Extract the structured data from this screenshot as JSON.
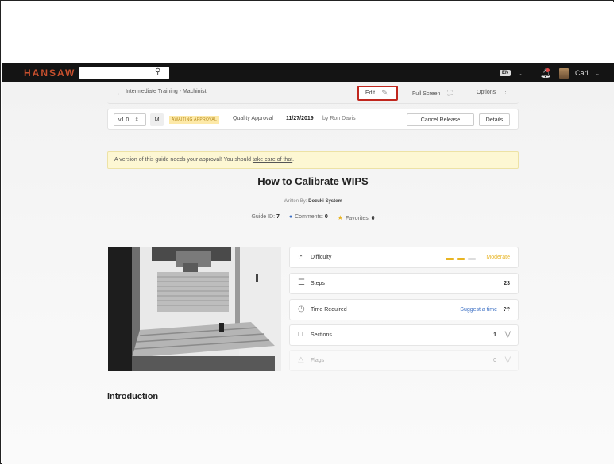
{
  "app": {
    "brand": "HANSAW",
    "search_placeholder": "",
    "lang": "EN",
    "user": "Carl"
  },
  "nav": {
    "breadcrumb": "Intermediate Training - Machinist",
    "edit": "Edit",
    "full_screen": "Full Screen",
    "options": "Options"
  },
  "release": {
    "version": "v1.0",
    "mode": "M",
    "status": "AWAITING APPROVAL",
    "stage": "Quality Approval",
    "date": "11/27/2019",
    "by": "by Ron Davis",
    "cancel": "Cancel Release",
    "details": "Details"
  },
  "notice": {
    "text": "A version of this guide needs your approval! You should ",
    "link": "take care of that",
    "end": "."
  },
  "guide": {
    "title": "How to Calibrate WIPS",
    "written_label": "Written By: ",
    "author": "Dozuki System",
    "id_label": "Guide ID: ",
    "id": "7",
    "comments_label": "Comments: ",
    "comments": "0",
    "favorites_label": "Favorites: ",
    "favorites": "0"
  },
  "stats": {
    "difficulty": {
      "label": "Difficulty",
      "value": "Moderate"
    },
    "steps": {
      "label": "Steps",
      "value": "23"
    },
    "time": {
      "label": "Time Required",
      "link": "Suggest a time",
      "value": "??"
    },
    "sections": {
      "label": "Sections",
      "value": "1"
    },
    "flags": {
      "label": "Flags",
      "value": "0"
    }
  },
  "intro": "Introduction",
  "colors": {
    "accent": "#c0271e",
    "brand": "#c8502e",
    "moderate": "#e8b422"
  }
}
